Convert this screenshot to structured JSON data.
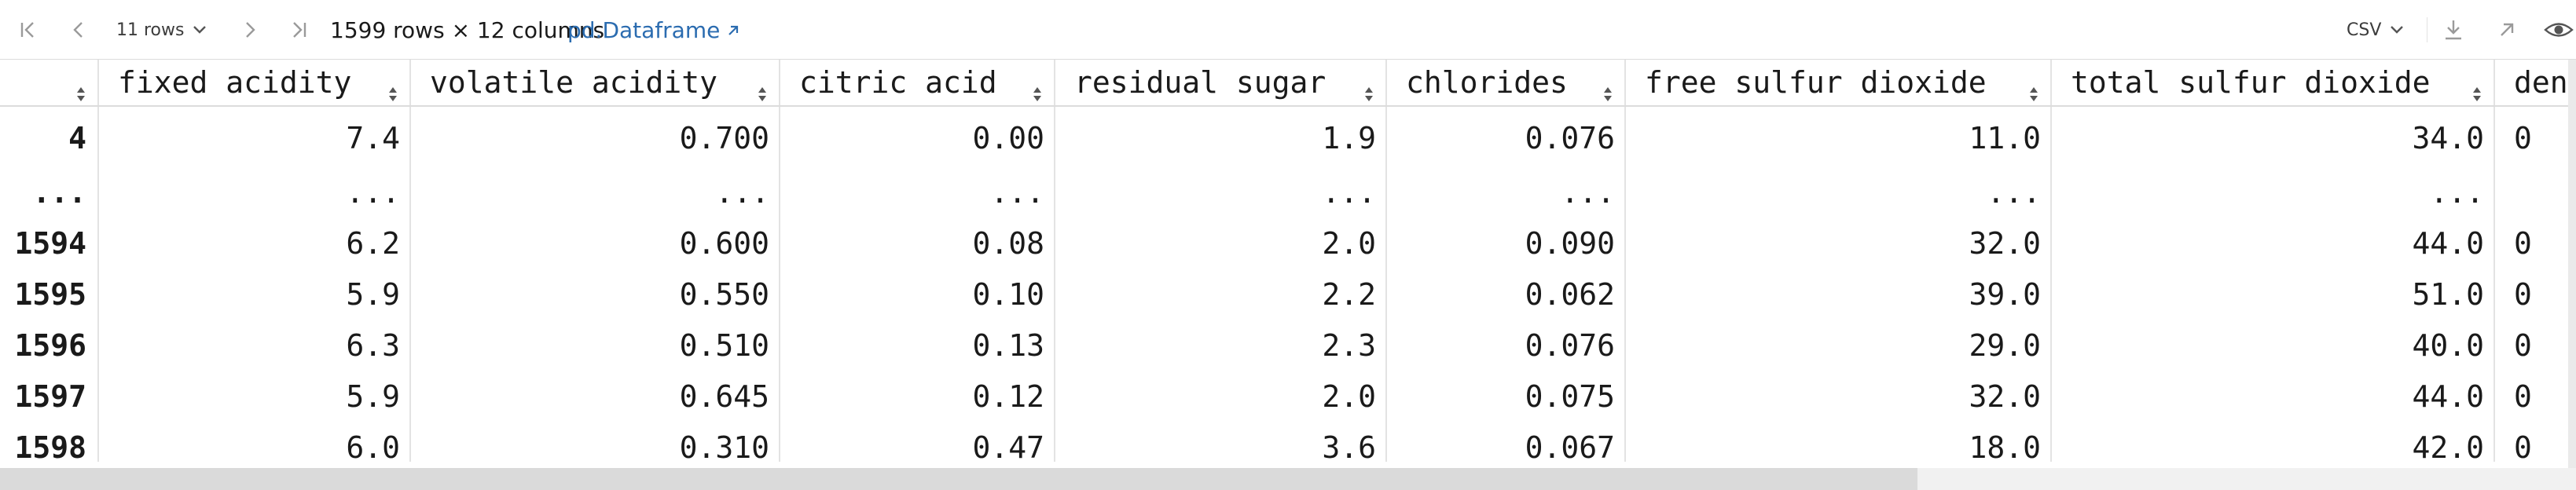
{
  "toolbar": {
    "rows_label": "11 rows",
    "dimensions": "1599 rows × 12 columns",
    "link_label": "pd.Dataframe",
    "export_format": "CSV",
    "icons": [
      "first-page-icon",
      "prev-page-icon",
      "chevron-down-icon",
      "next-page-icon",
      "last-page-icon",
      "external-link-icon",
      "download-icon",
      "open-external-icon",
      "eye-icon"
    ]
  },
  "table": {
    "columns": [
      "fixed acidity",
      "volatile acidity",
      "citric acid",
      "residual sugar",
      "chlorides",
      "free sulfur dioxide",
      "total sulfur dioxide",
      "den"
    ],
    "rows": [
      {
        "index": "4",
        "cells": [
          "7.4",
          "0.700",
          "0.00",
          "1.9",
          "0.076",
          "11.0",
          "34.0",
          "0"
        ]
      },
      {
        "index": "...",
        "cells": [
          "...",
          "...",
          "...",
          "...",
          "...",
          "...",
          "...",
          ""
        ]
      },
      {
        "index": "1594",
        "cells": [
          "6.2",
          "0.600",
          "0.08",
          "2.0",
          "0.090",
          "32.0",
          "44.0",
          "0"
        ]
      },
      {
        "index": "1595",
        "cells": [
          "5.9",
          "0.550",
          "0.10",
          "2.2",
          "0.062",
          "39.0",
          "51.0",
          "0"
        ]
      },
      {
        "index": "1596",
        "cells": [
          "6.3",
          "0.510",
          "0.13",
          "2.3",
          "0.076",
          "29.0",
          "40.0",
          "0"
        ]
      },
      {
        "index": "1597",
        "cells": [
          "5.9",
          "0.645",
          "0.12",
          "2.0",
          "0.075",
          "32.0",
          "44.0",
          "0"
        ]
      },
      {
        "index": "1598",
        "cells": [
          "6.0",
          "0.310",
          "0.47",
          "3.6",
          "0.067",
          "18.0",
          "42.0",
          "0"
        ]
      }
    ]
  }
}
